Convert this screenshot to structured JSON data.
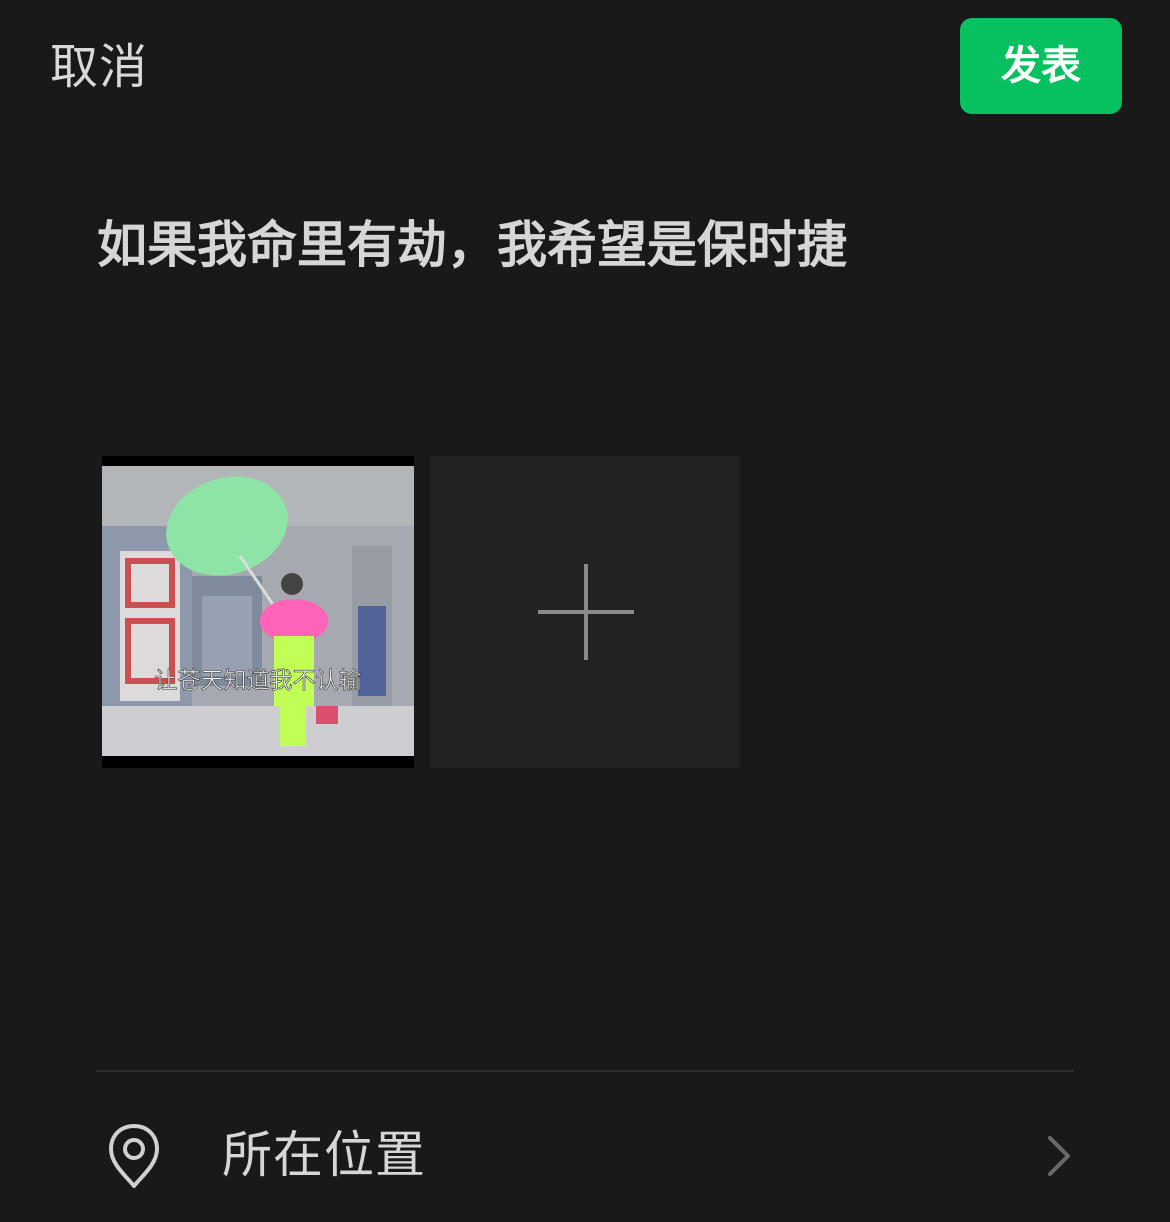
{
  "header": {
    "cancel_label": "取消",
    "publish_label": "发表",
    "accent_color": "#07c160"
  },
  "post": {
    "text": "如果我命里有劫，我希望是保时捷"
  },
  "media": {
    "thumbnail": {
      "caption": "让苍天知道我不认输"
    },
    "add_icon": "plus-icon"
  },
  "options": {
    "location_label": "所在位置",
    "location_icon": "location-pin-icon",
    "chevron_icon": "chevron-right-icon"
  }
}
